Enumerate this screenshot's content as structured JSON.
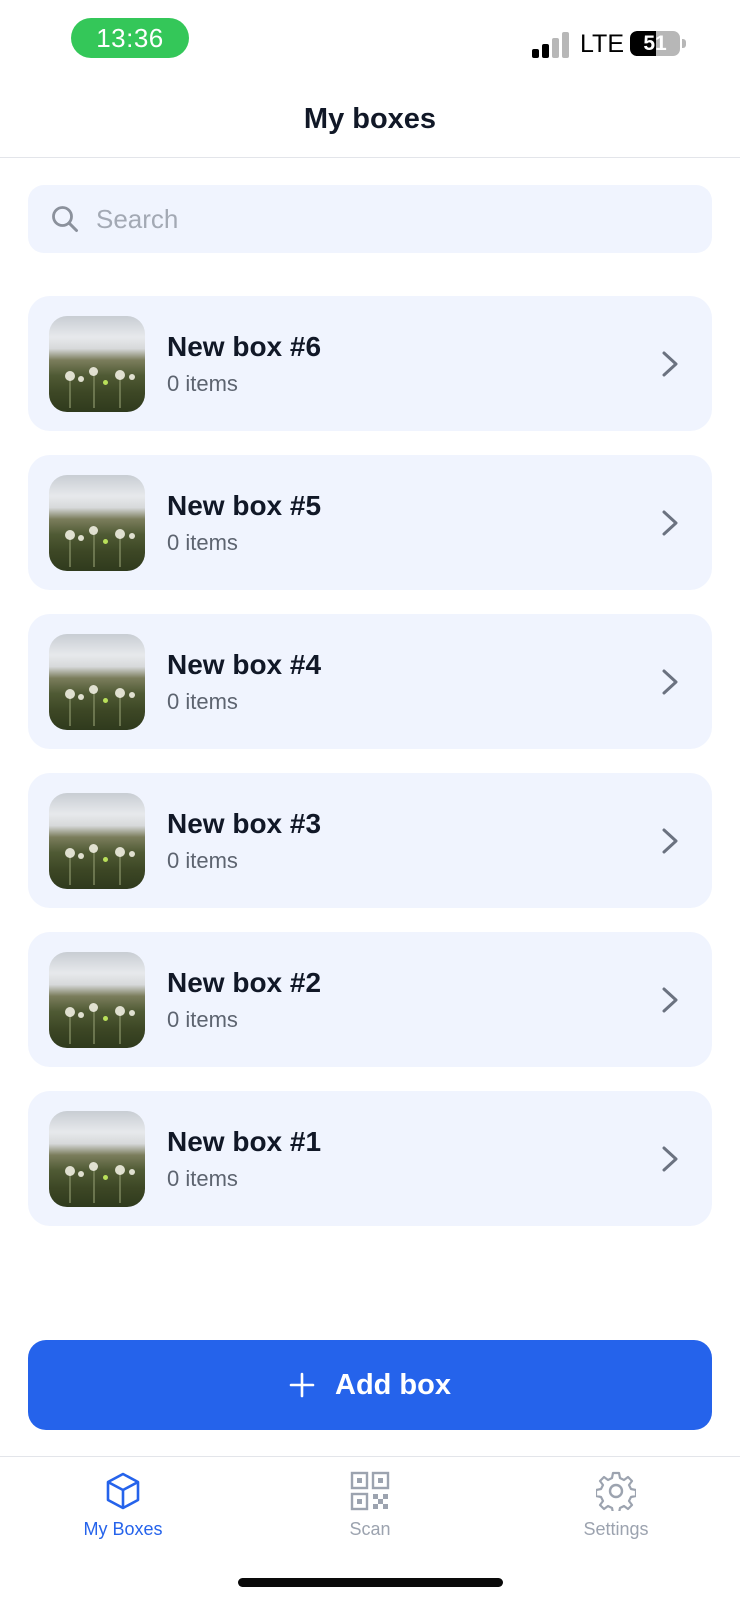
{
  "status_bar": {
    "time": "13:36",
    "network": "LTE",
    "battery_percent": "51",
    "battery_level": 0.51,
    "signal_bars_active": 2,
    "signal_bars_total": 4
  },
  "header": {
    "title": "My boxes"
  },
  "search": {
    "placeholder": "Search",
    "value": ""
  },
  "boxes": [
    {
      "title": "New box #6",
      "subtitle": "0 items"
    },
    {
      "title": "New box #5",
      "subtitle": "0 items"
    },
    {
      "title": "New box #4",
      "subtitle": "0 items"
    },
    {
      "title": "New box #3",
      "subtitle": "0 items"
    },
    {
      "title": "New box #2",
      "subtitle": "0 items"
    },
    {
      "title": "New box #1",
      "subtitle": "0 items"
    }
  ],
  "add_button": {
    "label": "Add box",
    "icon": "plus-icon"
  },
  "tabbar": {
    "tabs": [
      {
        "label": "My Boxes",
        "icon": "box-icon",
        "active": true
      },
      {
        "label": "Scan",
        "icon": "qr-code-icon",
        "active": false
      },
      {
        "label": "Settings",
        "icon": "gear-icon",
        "active": false
      }
    ]
  },
  "colors": {
    "accent": "#2563eb",
    "card_background": "#f0f4fe",
    "status_time_pill": "#34c759",
    "muted_text": "#9ca3af"
  }
}
